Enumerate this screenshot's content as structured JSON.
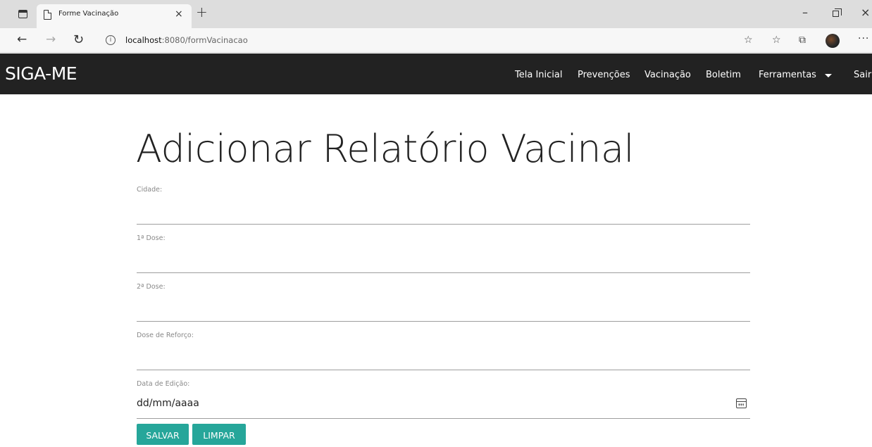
{
  "browser": {
    "tab_title": "Forme Vacinação",
    "tab_close": "×",
    "new_tab": "+",
    "url_host": "localhost",
    "url_rest": ":8080/formVacinacao",
    "window_min": "–",
    "window_close": "×",
    "more": "···"
  },
  "navbar": {
    "brand": "SIGA-ME",
    "items": [
      "Tela Inicial",
      "Prevenções",
      "Vacinação",
      "Boletim",
      "Ferramentas",
      "Sair"
    ]
  },
  "form": {
    "title": "Adicionar Relatório Vacinal",
    "fields": [
      {
        "label": "Cidade:",
        "value": ""
      },
      {
        "label": "1ª Dose:",
        "value": ""
      },
      {
        "label": "2ª Dose:",
        "value": ""
      },
      {
        "label": "Dose de Reforço:",
        "value": ""
      },
      {
        "label": "Data de Edição:",
        "value": "dd/mm/aaaa"
      }
    ],
    "buttons": {
      "save": "SALVAR",
      "clear": "LIMPAR"
    }
  },
  "colors": {
    "navbar_bg": "#222222",
    "button_accent": "#26a69a",
    "input_line": "#9e9e9e"
  }
}
